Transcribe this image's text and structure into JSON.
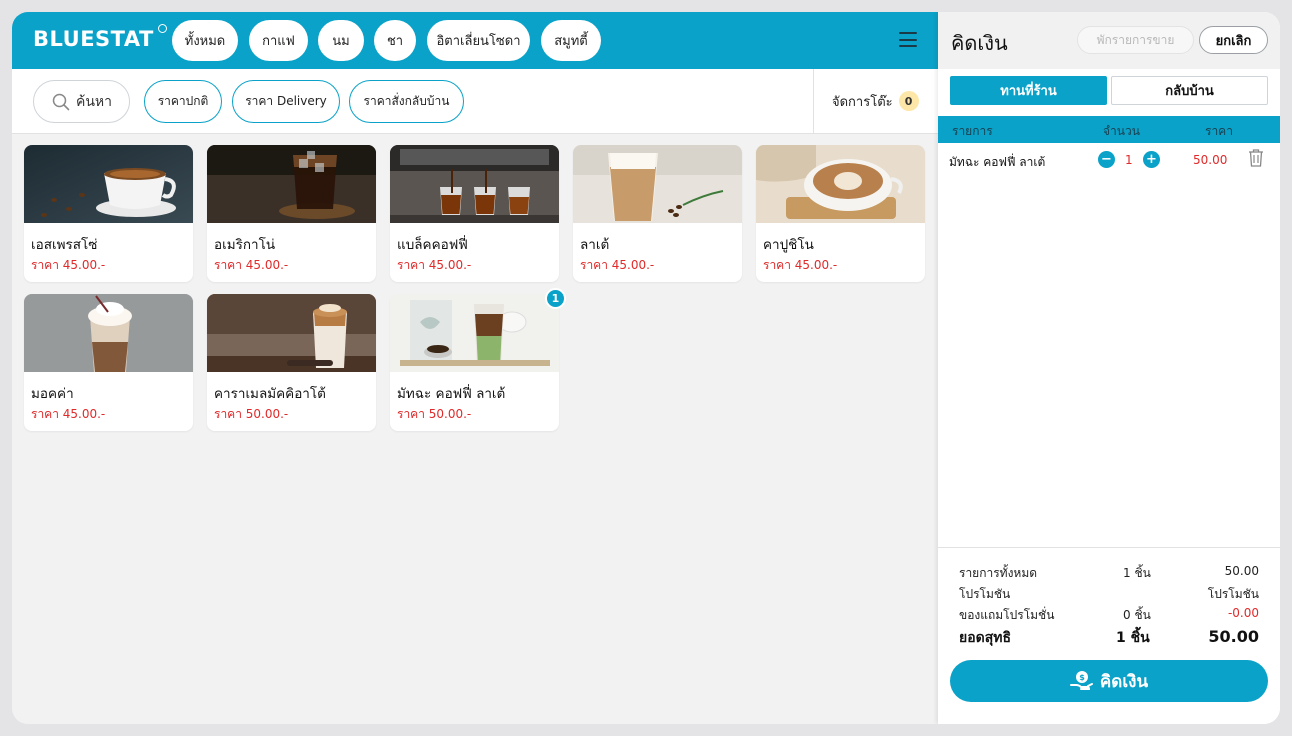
{
  "app": {
    "logo": "BLUESTAT"
  },
  "categories": [
    {
      "label": "ทั้งหมด",
      "active": true
    },
    {
      "label": "กาแฟ"
    },
    {
      "label": "นม"
    },
    {
      "label": "ชา"
    },
    {
      "label": "อิตาเลี่ยนโซดา"
    },
    {
      "label": "สมูทตี้"
    }
  ],
  "toolbar": {
    "search_label": "ค้นหา",
    "price_modes": [
      "ราคาปกติ",
      "ราคา Delivery",
      "ราคาสั่งกลับบ้าน"
    ],
    "table_manage_label": "จัดการโต๊ะ",
    "table_count": "0"
  },
  "products": [
    {
      "name": "เอสเพรสโซ่",
      "price": "ราคา 45.00.-",
      "icon": "espresso-photo"
    },
    {
      "name": "อเมริกาโน่",
      "price": "ราคา 45.00.-",
      "icon": "americano-photo"
    },
    {
      "name": "แบล็คคอฟฟี่",
      "price": "ราคา 45.00.-",
      "icon": "black-coffee-photo"
    },
    {
      "name": "ลาเต้",
      "price": "ราคา 45.00.-",
      "icon": "latte-photo"
    },
    {
      "name": "คาปูชิโน",
      "price": "ราคา 45.00.-",
      "icon": "cappuccino-photo"
    },
    {
      "name": "มอคค่า",
      "price": "ราคา 45.00.-",
      "icon": "mocha-photo"
    },
    {
      "name": "คาราเมลมัคคิอาโต้",
      "price": "ราคา 50.00.-",
      "icon": "caramel-macchiato-photo"
    },
    {
      "name": "มัทฉะ คอฟฟี่ ลาเต้",
      "price": "ราคา 50.00.-",
      "icon": "matcha-coffee-latte-photo",
      "badge": "1"
    }
  ],
  "checkout": {
    "title": "คิดเงิน",
    "hold_label": "พักรายการขาย",
    "cancel_label": "ยกเลิก",
    "modes": [
      "ทานที่ร้าน",
      "กลับบ้าน"
    ],
    "columns": {
      "item": "รายการ",
      "qty": "จำนวน",
      "price": "ราคา"
    },
    "items": [
      {
        "name": "มัทฉะ คอฟฟี่ ลาเต้",
        "qty": "1",
        "price": "50.00"
      }
    ],
    "summary": {
      "all_items_label": "รายการทั้งหมด",
      "all_items_qty": "1 ชิ้น",
      "all_items_value": "50.00",
      "promo_label": "โปรโมชัน",
      "promo_value": "โปรโมชัน",
      "gift_label": "ของแถมโปรโมชั่น",
      "gift_qty": "0 ชิ้น",
      "gift_value": "-0.00",
      "net_label": "ยอดสุทธิ",
      "net_qty": "1 ชิ้น",
      "net_value": "50.00"
    },
    "pay_label": "คิดเงิน"
  },
  "colors": {
    "brand": "#0aa2c8",
    "price": "#e02a2a",
    "badge_table": "#fde7a8"
  }
}
